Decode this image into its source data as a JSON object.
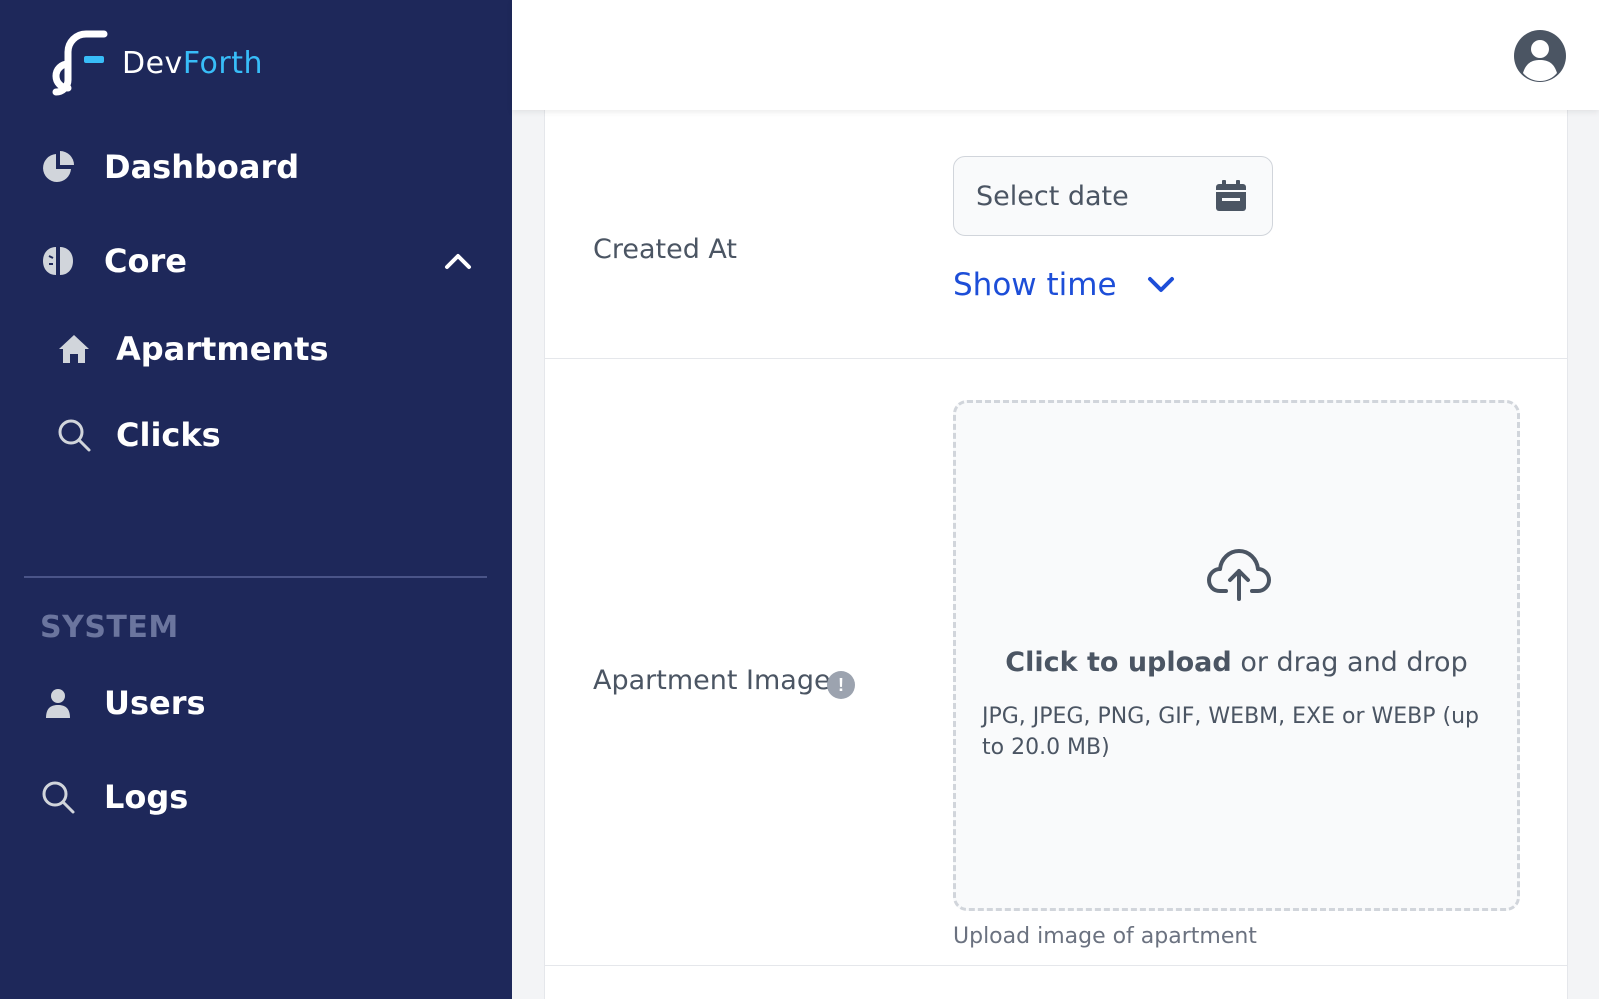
{
  "brand": {
    "part1": "Dev",
    "part2": "Forth",
    "accent": "#38bdf8",
    "sidebar_bg": "#1e285a"
  },
  "sidebar": {
    "items": [
      {
        "label": "Dashboard",
        "icon": "pie-chart-icon"
      },
      {
        "label": "Core",
        "icon": "brain-icon",
        "expanded": true,
        "children": [
          {
            "label": "Apartments",
            "icon": "home-icon"
          },
          {
            "label": "Clicks",
            "icon": "search-icon"
          }
        ]
      }
    ],
    "section": "SYSTEM",
    "system_items": [
      {
        "label": "Users",
        "icon": "user-icon"
      },
      {
        "label": "Logs",
        "icon": "search-icon"
      }
    ]
  },
  "header": {
    "avatar_icon": "user-circle-icon"
  },
  "form": {
    "created_at": {
      "label": "Created At",
      "placeholder": "Select date",
      "show_time": "Show time"
    },
    "apartment_image": {
      "label": "Apartment Image",
      "info": "!",
      "upload_bold": "Click to upload",
      "upload_rest": " or drag and drop",
      "formats": "JPG, JPEG, PNG, GIF, WEBM, EXE or WEBP (up to 20.0 MB)",
      "help": "Upload image of apartment"
    }
  },
  "colors": {
    "link": "#1d4ed8",
    "text": "#4b5563"
  }
}
